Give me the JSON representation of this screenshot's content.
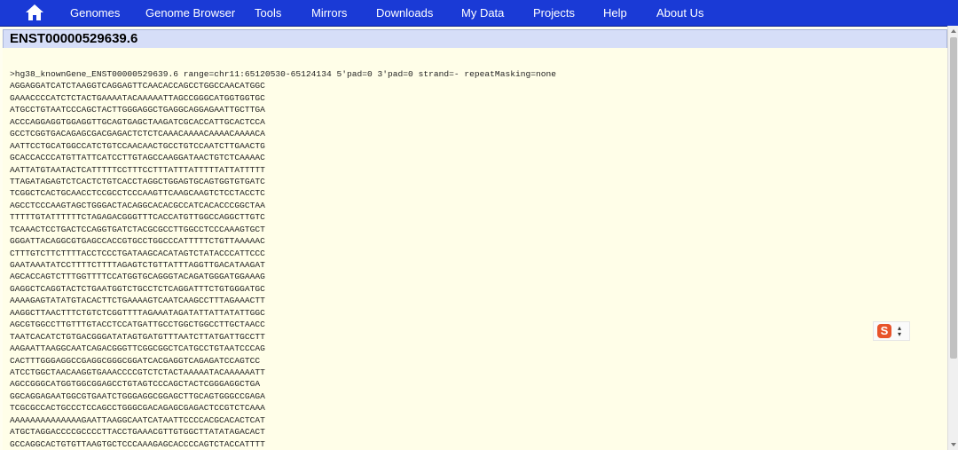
{
  "nav": {
    "items": [
      "Genomes",
      "Genome Browser",
      "Tools",
      "Mirrors",
      "Downloads",
      "My Data",
      "Projects",
      "Help",
      "About Us"
    ]
  },
  "page": {
    "title": "ENST00000529639.6",
    "header_line": ">hg38_knownGene_ENST00000529639.6 range=chr11:65120530-65124134 5'pad=0 3'pad=0 strand=- repeatMasking=none",
    "sequence_lines": [
      "AGGAGGATCATCTAAGGTCAGGAGTTCAACACCAGCCTGGCCAACATGGC",
      "GAAACCCCATCTCTACTGAAAATACAAAAATTAGCCGGGCATGGTGGTGC",
      "ATGCCTGTAATCCCAGCTACTTGGGAGGCTGAGGCAGGAGAATTGCTTGA",
      "ACCCAGGAGGTGGAGGTTGCAGTGAGCTAAGATCGCACCATTGCACTCCA",
      "GCCTCGGTGACAGAGCGACGAGACTCTCTCAAACAAAACAAAACAAAACA",
      "AATTCCTGCATGGCCATCTGTCCAACAACTGCCTGTCCAATCTTGAACTG",
      "GCACCACCCATGTTATTCATCCTTGTAGCCAAGGATAACTGTCTCAAAAC",
      "AATTATGTAATACTCATTTTTCCTTTCCTTTATTTATTTTTATTATTTTT",
      "TTAGATAGAGTCTCACTCTGTCACCTAGGCTGGAGTGCAGTGGTGTGATC",
      "TCGGCTCACTGCAACCTCCGCCTCCCAAGTTCAAGCAAGTCTCCTACCTC",
      "AGCCTCCCAAGTAGCTGGGACTACAGGCACACGCCATCACACCCGGCTAA",
      "TTTTTGTATTTTTTCTAGAGACGGGTTTCACCATGTTGGCCAGGCTTGTC",
      "TCAAACTCCTGACTCCAGGTGATCTACGCGCCTTGGCCTCCCAAAGTGCT",
      "GGGATTACAGGCGTGAGCCACCGTGCCTGGCCCATTTTTCTGTTAAAAAC",
      "CTTTGTCTTCTTTTACCTCCCTGATAAGCACATAGTCTATACCCATTCCC",
      "GAATAAATATCCTTTTCTTTTAGAGTCTGTTATTTAGGTTGACATAAGAT",
      "AGCACCAGTCTTTGGTTTTCCATGGTGCAGGGTACAGATGGGATGGAAAG",
      "GAGGCTCAGGTACTCTGAATGGTCTGCCTCTCAGGATTTCTGTGGGATGC",
      "AAAAGAGTATATGTACACTTCTGAAAAGTCAATCAAGCCTTTAGAAACTT",
      "AAGGCTTAACTTTCTGTCTCGGTTTTAGAAATAGATATTATTATATTGGC",
      "AGCGTGGCCTTGTTTGTACCTCCATGATTGCCTGGCTGGCCTTGCTAACC",
      "TAATCACATCTGTGACGGGATATAGTGATGTTTAATCTTATGATTGCCTT",
      "AAGAATTAAGGCAATCAGACGGGTTCGGCGGCTCATGCCTGTAATCCCAG",
      "CACTTTGGGAGGCCGAGGCGGGCGGATCACGAGGTCAGAGATCCAGTCC",
      "ATCCTGGCTAACAAGGTGAAACCCCGTCTCTACTAAAAATACAAAAAATT",
      "AGCCGGGCATGGTGGCGGAGCCTGTAGTCCCAGCTACTCGGGAGGCTGA",
      "GGCAGGAGAATGGCGTGAATCTGGGAGGCGGAGCTTGCAGTGGGCCGAGA",
      "TCGCGCCACTGCCCTCCAGCCTGGGCGACAGAGCGAGACTCCGTCTCAAA",
      "AAAAAAAAAAAAAAGAATTAAGGCAATCATAATTCCCCACGCACACTCAT",
      "ATGCTAGGACCCCGCCCCTTACCTGAAACGTTGTGGCTTATATAGACACT",
      "GCCAGGCACTGTGTTAAGTGCTCCCAAAGAGCACCCCAGTCTACCATTTT"
    ]
  },
  "widget": {
    "label": "S"
  }
}
